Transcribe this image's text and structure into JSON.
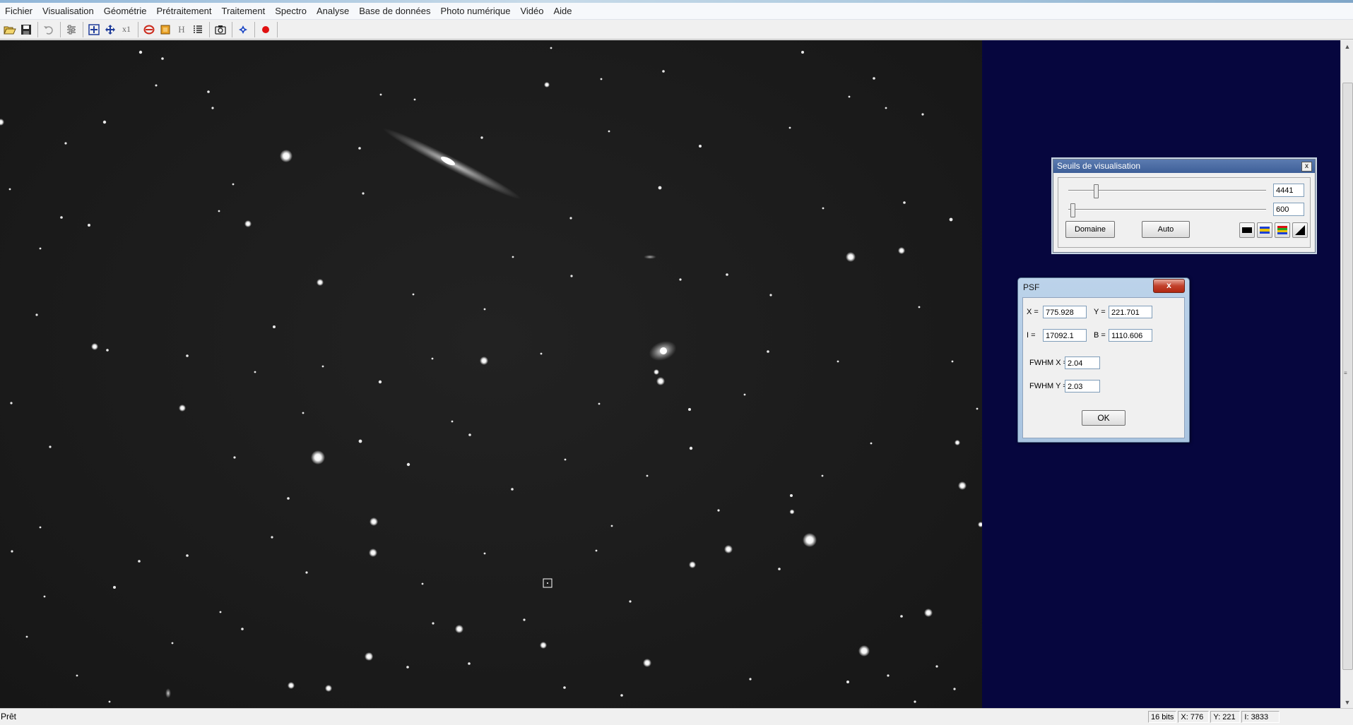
{
  "menu": [
    "Fichier",
    "Visualisation",
    "Géométrie",
    "Prétraitement",
    "Traitement",
    "Spectro",
    "Analyse",
    "Base de données",
    "Photo numérique",
    "Vidéo",
    "Aide"
  ],
  "toolbar": {
    "buttons": [
      "open-icon",
      "save-icon",
      "undo-icon",
      "settings-icon",
      "zoom-fit-icon",
      "move-icon",
      "zoom-x1-icon",
      "flip-icon",
      "palette-icon",
      "histogram-icon",
      "list-icon",
      "camera-icon",
      "crosshair-icon",
      "record-icon"
    ],
    "zoom_label": "x1",
    "hist_label": "H"
  },
  "seuils": {
    "title": "Seuils de visualisation",
    "close": "x",
    "high_value": "4441",
    "high_level": 0.14,
    "low_value": "600",
    "low_level": 0.02,
    "domaine_label": "Domaine",
    "auto_label": "Auto"
  },
  "psf": {
    "title": "PSF",
    "close": "x",
    "x_label": "X =",
    "x_value": "775.928",
    "y_label": "Y =",
    "y_value": "221.701",
    "i_label": "I =",
    "i_value": "17092.1",
    "b_label": "B =",
    "b_value": "1110.606",
    "fwhm_x_label": "FWHM X =",
    "fwhm_x_value": "2.04",
    "fwhm_y_label": "FWHM Y =",
    "fwhm_y_value": "2.03",
    "ok_label": "OK"
  },
  "status": {
    "ready": "Prêt",
    "bits": "16 bits",
    "x": "X: 776",
    "y": "Y: 221",
    "intensity": "I: 3833"
  }
}
